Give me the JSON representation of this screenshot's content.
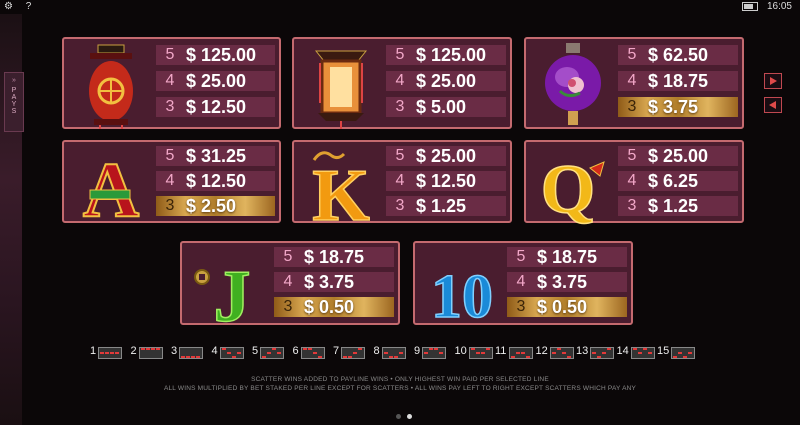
{
  "status_bar": {
    "settings_icon": "gear-icon",
    "help_label": "?",
    "time": "16:05"
  },
  "side_tab": {
    "label": "PAYS"
  },
  "navigation": {
    "next_icon": "arrow-right-icon",
    "prev_icon": "arrow-left-icon"
  },
  "colors": {
    "panel_border": "#c46a6f",
    "panel_bg": "#4a1d2f",
    "row_bg": "#6a2c45",
    "count_color": "#f2a7c8",
    "gold_row": "#d9a850"
  },
  "paytable": [
    {
      "symbol": "Red lantern",
      "icon": "red-lantern-icon",
      "rows": [
        {
          "count": "5",
          "value": "$ 125.00"
        },
        {
          "count": "4",
          "value": "$ 25.00"
        },
        {
          "count": "3",
          "value": "$ 12.50"
        }
      ]
    },
    {
      "symbol": "Hanging lantern",
      "icon": "hanging-lantern-icon",
      "rows": [
        {
          "count": "5",
          "value": "$ 125.00"
        },
        {
          "count": "4",
          "value": "$ 25.00"
        },
        {
          "count": "3",
          "value": "$ 5.00"
        }
      ]
    },
    {
      "symbol": "Purple lantern",
      "icon": "purple-lantern-icon",
      "rows": [
        {
          "count": "5",
          "value": "$ 62.50"
        },
        {
          "count": "4",
          "value": "$ 18.75"
        },
        {
          "count": "3",
          "value": "$ 3.75"
        }
      ]
    },
    {
      "symbol": "A",
      "icon": "letter-a-icon",
      "rows": [
        {
          "count": "5",
          "value": "$ 31.25"
        },
        {
          "count": "4",
          "value": "$ 12.50"
        },
        {
          "count": "3",
          "value": "$ 2.50"
        }
      ]
    },
    {
      "symbol": "K",
      "icon": "letter-k-icon",
      "rows": [
        {
          "count": "5",
          "value": "$ 25.00"
        },
        {
          "count": "4",
          "value": "$ 12.50"
        },
        {
          "count": "3",
          "value": "$ 1.25"
        }
      ]
    },
    {
      "symbol": "Q",
      "icon": "letter-q-icon",
      "rows": [
        {
          "count": "5",
          "value": "$ 25.00"
        },
        {
          "count": "4",
          "value": "$ 6.25"
        },
        {
          "count": "3",
          "value": "$ 1.25"
        }
      ]
    },
    {
      "symbol": "J",
      "icon": "letter-j-icon",
      "rows": [
        {
          "count": "5",
          "value": "$ 18.75"
        },
        {
          "count": "4",
          "value": "$ 3.75"
        },
        {
          "count": "3",
          "value": "$ 0.50"
        }
      ]
    },
    {
      "symbol": "10",
      "icon": "number-10-icon",
      "rows": [
        {
          "count": "5",
          "value": "$ 18.75"
        },
        {
          "count": "4",
          "value": "$ 3.75"
        },
        {
          "count": "3",
          "value": "$ 0.50"
        }
      ]
    }
  ],
  "paylines": [
    "1",
    "2",
    "3",
    "4",
    "5",
    "6",
    "7",
    "8",
    "9",
    "10",
    "11",
    "12",
    "13",
    "14",
    "15"
  ],
  "rules": {
    "line1": "SCATTER WINS ADDED TO PAYLINE WINS  •  ONLY HIGHEST WIN PAID PER SELECTED LINE",
    "line2": "ALL WINS MULTIPLIED BY BET STAKED PER LINE EXCEPT FOR SCATTERS  •  ALL WINS PAY LEFT TO RIGHT EXCEPT SCATTERS WHICH PAY ANY"
  },
  "pagination": {
    "pages": 2,
    "current": 2
  }
}
